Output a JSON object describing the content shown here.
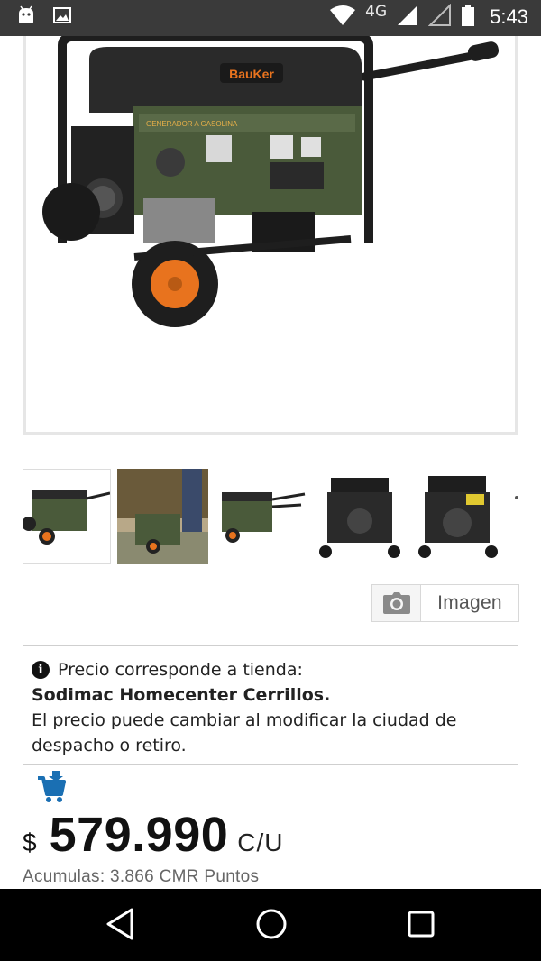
{
  "status_bar": {
    "network": "4G",
    "time": "5:43",
    "icons": [
      "android-debug-icon",
      "gallery-icon",
      "wifi-icon",
      "signal-icon",
      "signal-empty-icon",
      "battery-icon"
    ]
  },
  "product": {
    "image_brand": "BauKer",
    "image_alt": "Generador a gasolina"
  },
  "thumbnails": [
    {
      "name": "thumb-1",
      "active": true
    },
    {
      "name": "thumb-2",
      "active": false
    },
    {
      "name": "thumb-3",
      "active": false
    },
    {
      "name": "thumb-4",
      "active": false
    },
    {
      "name": "thumb-5",
      "active": false
    }
  ],
  "image_button": {
    "label": "Imagen",
    "icon": "camera-icon"
  },
  "notice": {
    "line1": "Precio corresponde a tienda:",
    "store": "Sodimac Homecenter Cerrillos.",
    "line3": "El precio puede cambiar al modificar la ciudad de despacho o retiro."
  },
  "price": {
    "currency": "$",
    "amount": "579.990",
    "unit": "C/U"
  },
  "points": "Acumulas: 3.866 CMR Puntos",
  "colors": {
    "status_bar": "#3a3a3a",
    "cart_blue": "#1a6fb3",
    "generator_green": "#4a5a3a",
    "wheel_orange": "#e8731e"
  },
  "nav": [
    "back-icon",
    "home-icon",
    "recents-icon"
  ]
}
